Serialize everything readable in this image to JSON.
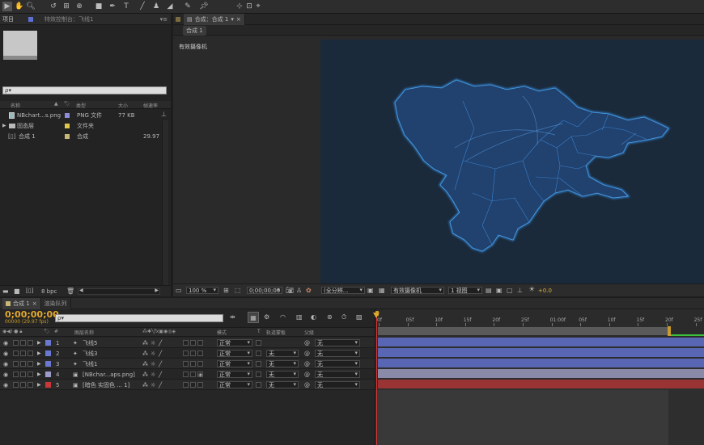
{
  "project_panel": {
    "tab_project": "项目",
    "tab_effects": "特效控制台：飞线1",
    "search_placeholder": "ρ▾",
    "columns": {
      "name": "名称",
      "type": "类型",
      "size": "大小",
      "rate": "帧速率"
    },
    "items": [
      {
        "name": "NBchart...s.png",
        "type": "PNG 文件",
        "size": "77 KB",
        "rate": "",
        "swatch": "#8c8cd8"
      },
      {
        "name": "固态层",
        "type": "文件夹",
        "size": "",
        "rate": "",
        "swatch": "#e0c84a"
      },
      {
        "name": "合成 1",
        "type": "合成",
        "size": "",
        "rate": "29.97",
        "swatch": "#c8b878"
      }
    ],
    "bpc": "8 bpc"
  },
  "comp_panel": {
    "tab": "合成：合成 1",
    "subtab": "合成 1",
    "camera_label": "有效摄像机",
    "zoom": "100 %",
    "timecode": "0;00;00;00",
    "resolution": "(全分辨...",
    "camera_select": "有效摄像机",
    "view_select": "1 视图",
    "exposure": "+0.0"
  },
  "timeline": {
    "tab_comp": "合成 1",
    "tab_render": "渲染队列",
    "timecode": "0;00;00;00",
    "fps": "00000 (29.97 fps)",
    "search_placeholder": "ρ▾",
    "columns": {
      "source": "图层名称",
      "mode": "模式",
      "t": "T",
      "trkmat": "轨道蒙板",
      "parent": "父级"
    },
    "ruler": [
      "0f",
      "05f",
      "10f",
      "15f",
      "20f",
      "25f",
      "01:00f",
      "05f",
      "10f",
      "15f",
      "20f",
      "25f"
    ],
    "layers": [
      {
        "num": "1",
        "name": "飞线5",
        "color": "#6a78d0",
        "mode": "正常",
        "trkmat": "",
        "parent": "无",
        "bar": "#5866b4"
      },
      {
        "num": "2",
        "name": "飞线3",
        "color": "#6a78d0",
        "mode": "正常",
        "trkmat": "无",
        "parent": "无",
        "bar": "#5866b4"
      },
      {
        "num": "3",
        "name": "飞线1",
        "color": "#6a78d0",
        "mode": "正常",
        "trkmat": "无",
        "parent": "无",
        "bar": "#5866b4"
      },
      {
        "num": "4",
        "name": "[NBchar...aps.png]",
        "color": "#9c9cc8",
        "mode": "正常",
        "trkmat": "无",
        "parent": "无",
        "bar": "#8a8aa8"
      },
      {
        "num": "5",
        "name": "[暗色 实固色 ... 1]",
        "color": "#c83838",
        "mode": "正常",
        "trkmat": "无",
        "parent": "无",
        "bar": "#9a3434"
      }
    ]
  }
}
